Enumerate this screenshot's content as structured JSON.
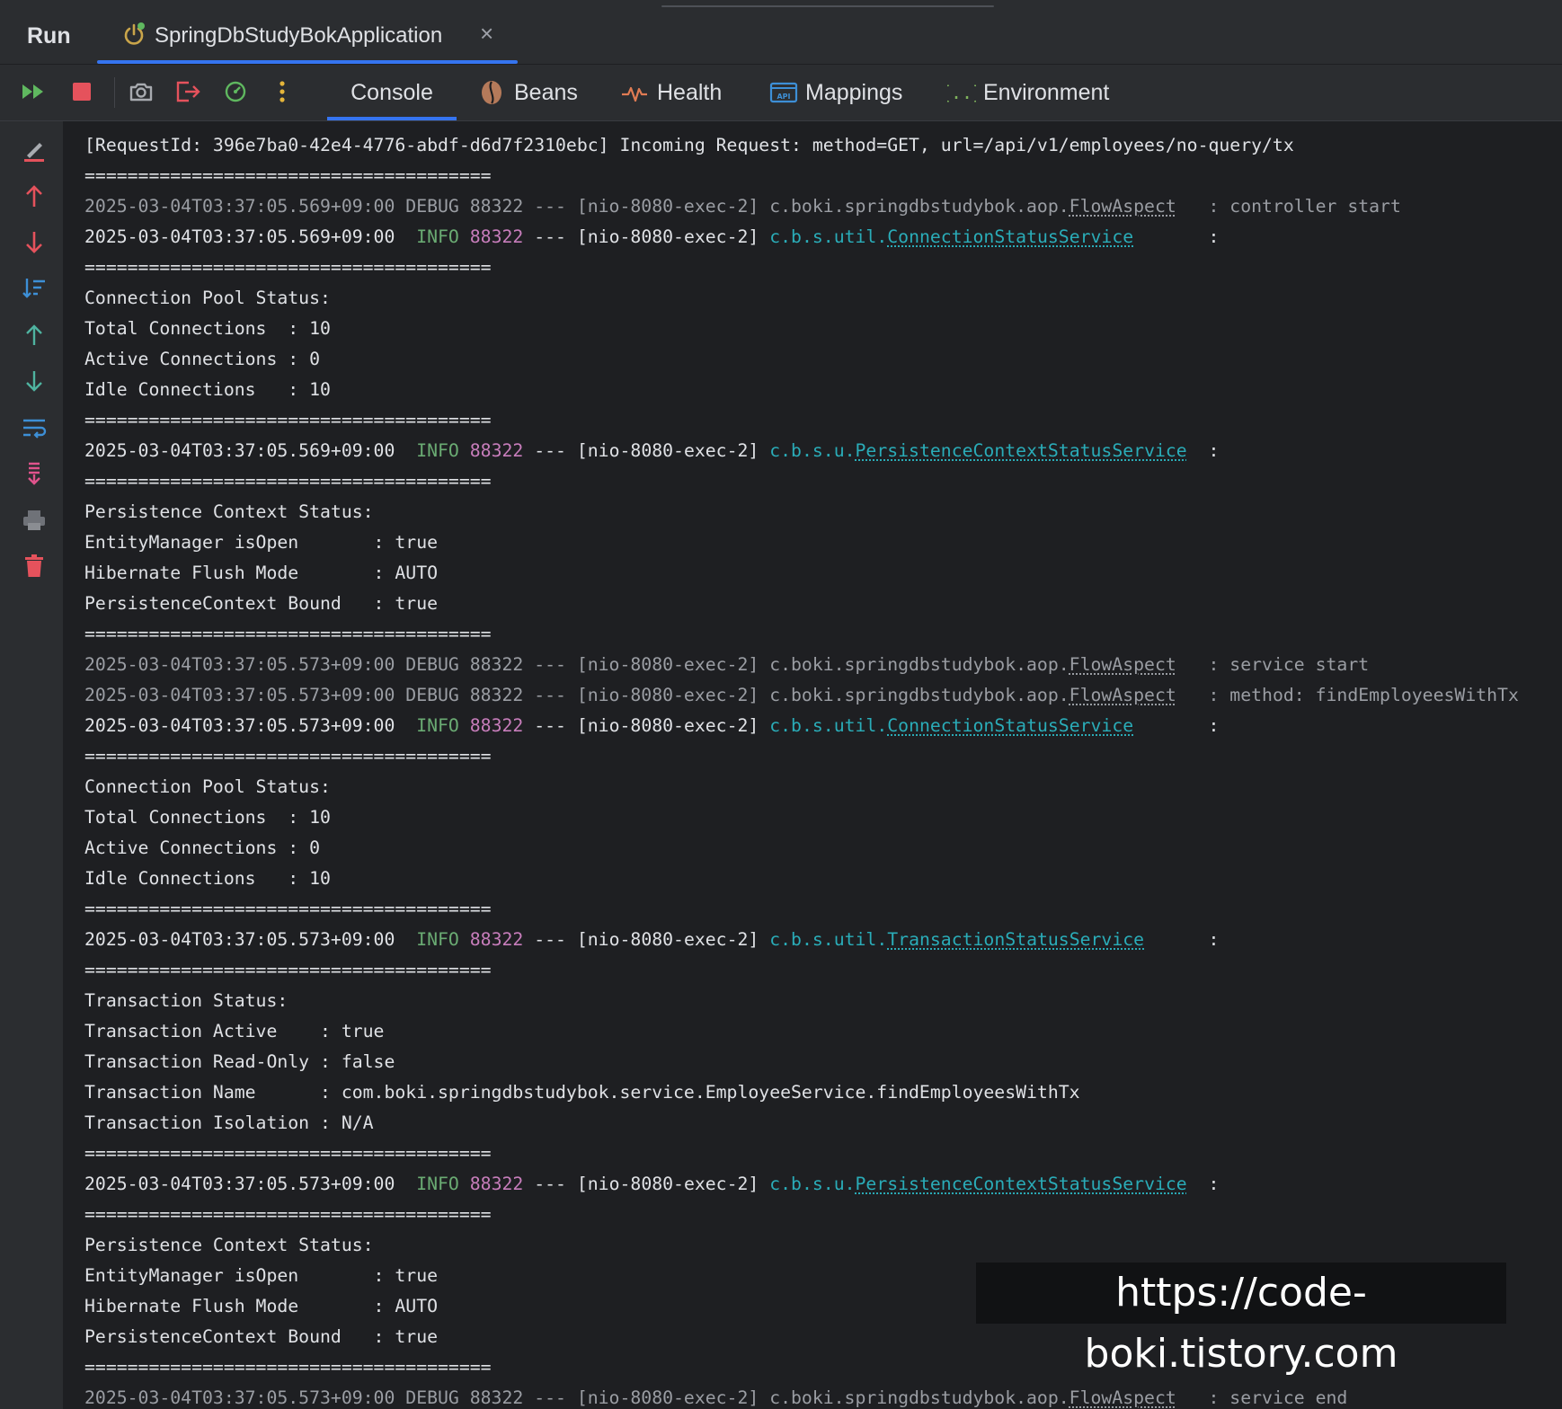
{
  "run_panel": {
    "label": "Run",
    "tab_title": "SpringDbStudyBokApplication",
    "close_glyph": "×"
  },
  "toolbar": {
    "icons": [
      "rerun-icon",
      "stop-icon",
      "camera-icon",
      "exit-icon",
      "profiler-icon",
      "more-icon"
    ],
    "tabs": [
      {
        "label": "Console",
        "icon": "console-icon",
        "active": true
      },
      {
        "label": "Beans",
        "icon": "beans-icon",
        "active": false
      },
      {
        "label": "Health",
        "icon": "health-icon",
        "active": false
      },
      {
        "label": "Mappings",
        "icon": "api-icon",
        "active": false
      },
      {
        "label": "Environment",
        "icon": "braces-icon",
        "active": false
      }
    ]
  },
  "gutter": {
    "icons": [
      "clear-icon",
      "up-red-icon",
      "down-red-icon",
      "sort-icon",
      "up-arrow-icon",
      "down-arrow-icon",
      "soft-wrap-icon",
      "scroll-to-end-icon",
      "print-icon",
      "trash-icon"
    ]
  },
  "log_lines": [
    {
      "segments": [
        {
          "text": "[RequestId: 396e7ba0-42e4-4776-abdf-d6d7f2310ebc] Incoming Request: method=GET, url=/api/v1/employees/no-query/tx",
          "style": "plain"
        }
      ]
    },
    {
      "segments": [
        {
          "text": "======================================",
          "style": "plain"
        }
      ]
    },
    {
      "segments": [
        {
          "text": "2025-03-04T03:37:05.569+09:00 DEBUG 88322 --- [nio-8080-exec-2] c.boki.springdbstudybok.aop.",
          "style": "dim"
        },
        {
          "text": "FlowAspect",
          "style": "dimcls"
        },
        {
          "text": "   : controller start",
          "style": "dim"
        }
      ]
    },
    {
      "segments": [
        {
          "text": "2025-03-04T03:37:05.569+09:00  ",
          "style": "plain"
        },
        {
          "text": "INFO",
          "style": "green"
        },
        {
          "text": " ",
          "style": "plain"
        },
        {
          "text": "88322",
          "style": "magenta"
        },
        {
          "text": " --- [nio-8080-exec-2] ",
          "style": "plain"
        },
        {
          "text": "c.b.s.util.",
          "style": "cyan"
        },
        {
          "text": "ConnectionStatusService",
          "style": "cls"
        },
        {
          "text": "       :",
          "style": "plain"
        }
      ]
    },
    {
      "segments": [
        {
          "text": "======================================",
          "style": "plain"
        }
      ]
    },
    {
      "segments": [
        {
          "text": "Connection Pool Status:",
          "style": "plain"
        }
      ]
    },
    {
      "segments": [
        {
          "text": "Total Connections  : 10",
          "style": "plain"
        }
      ]
    },
    {
      "segments": [
        {
          "text": "Active Connections : 0",
          "style": "plain"
        }
      ]
    },
    {
      "segments": [
        {
          "text": "Idle Connections   : 10",
          "style": "plain"
        }
      ]
    },
    {
      "segments": [
        {
          "text": "======================================",
          "style": "plain"
        }
      ]
    },
    {
      "segments": [
        {
          "text": "2025-03-04T03:37:05.569+09:00  ",
          "style": "plain"
        },
        {
          "text": "INFO",
          "style": "green"
        },
        {
          "text": " ",
          "style": "plain"
        },
        {
          "text": "88322",
          "style": "magenta"
        },
        {
          "text": " --- [nio-8080-exec-2] ",
          "style": "plain"
        },
        {
          "text": "c.b.s.u.",
          "style": "cyan"
        },
        {
          "text": "PersistenceContextStatusService",
          "style": "cls"
        },
        {
          "text": "  :",
          "style": "plain"
        }
      ]
    },
    {
      "segments": [
        {
          "text": "======================================",
          "style": "plain"
        }
      ]
    },
    {
      "segments": [
        {
          "text": "Persistence Context Status:",
          "style": "plain"
        }
      ]
    },
    {
      "segments": [
        {
          "text": "EntityManager isOpen       : true",
          "style": "plain"
        }
      ]
    },
    {
      "segments": [
        {
          "text": "Hibernate Flush Mode       : AUTO",
          "style": "plain"
        }
      ]
    },
    {
      "segments": [
        {
          "text": "PersistenceContext Bound   : true",
          "style": "plain"
        }
      ]
    },
    {
      "segments": [
        {
          "text": "======================================",
          "style": "plain"
        }
      ]
    },
    {
      "segments": [
        {
          "text": "2025-03-04T03:37:05.573+09:00 DEBUG 88322 --- [nio-8080-exec-2] c.boki.springdbstudybok.aop.",
          "style": "dim"
        },
        {
          "text": "FlowAspect",
          "style": "dimcls"
        },
        {
          "text": "   : service start",
          "style": "dim"
        }
      ]
    },
    {
      "segments": [
        {
          "text": "2025-03-04T03:37:05.573+09:00 DEBUG 88322 --- [nio-8080-exec-2] c.boki.springdbstudybok.aop.",
          "style": "dim"
        },
        {
          "text": "FlowAspect",
          "style": "dimcls"
        },
        {
          "text": "   : method: findEmployeesWithTx",
          "style": "dim"
        }
      ]
    },
    {
      "segments": [
        {
          "text": "2025-03-04T03:37:05.573+09:00  ",
          "style": "plain"
        },
        {
          "text": "INFO",
          "style": "green"
        },
        {
          "text": " ",
          "style": "plain"
        },
        {
          "text": "88322",
          "style": "magenta"
        },
        {
          "text": " --- [nio-8080-exec-2] ",
          "style": "plain"
        },
        {
          "text": "c.b.s.util.",
          "style": "cyan"
        },
        {
          "text": "ConnectionStatusService",
          "style": "cls"
        },
        {
          "text": "       :",
          "style": "plain"
        }
      ]
    },
    {
      "segments": [
        {
          "text": "======================================",
          "style": "plain"
        }
      ]
    },
    {
      "segments": [
        {
          "text": "Connection Pool Status:",
          "style": "plain"
        }
      ]
    },
    {
      "segments": [
        {
          "text": "Total Connections  : 10",
          "style": "plain"
        }
      ]
    },
    {
      "segments": [
        {
          "text": "Active Connections : 0",
          "style": "plain"
        }
      ]
    },
    {
      "segments": [
        {
          "text": "Idle Connections   : 10",
          "style": "plain"
        }
      ]
    },
    {
      "segments": [
        {
          "text": "======================================",
          "style": "plain"
        }
      ]
    },
    {
      "segments": [
        {
          "text": "2025-03-04T03:37:05.573+09:00  ",
          "style": "plain"
        },
        {
          "text": "INFO",
          "style": "green"
        },
        {
          "text": " ",
          "style": "plain"
        },
        {
          "text": "88322",
          "style": "magenta"
        },
        {
          "text": " --- [nio-8080-exec-2] ",
          "style": "plain"
        },
        {
          "text": "c.b.s.util.",
          "style": "cyan"
        },
        {
          "text": "TransactionStatusService",
          "style": "cls"
        },
        {
          "text": "      :",
          "style": "plain"
        }
      ]
    },
    {
      "segments": [
        {
          "text": "======================================",
          "style": "plain"
        }
      ]
    },
    {
      "segments": [
        {
          "text": "Transaction Status:",
          "style": "plain"
        }
      ]
    },
    {
      "segments": [
        {
          "text": "Transaction Active    : true",
          "style": "plain"
        }
      ]
    },
    {
      "segments": [
        {
          "text": "Transaction Read-Only : false",
          "style": "plain"
        }
      ]
    },
    {
      "segments": [
        {
          "text": "Transaction Name      : com.boki.springdbstudybok.service.EmployeeService.findEmployeesWithTx",
          "style": "plain"
        }
      ]
    },
    {
      "segments": [
        {
          "text": "Transaction Isolation : N/A",
          "style": "plain"
        }
      ]
    },
    {
      "segments": [
        {
          "text": "======================================",
          "style": "plain"
        }
      ]
    },
    {
      "segments": [
        {
          "text": "2025-03-04T03:37:05.573+09:00  ",
          "style": "plain"
        },
        {
          "text": "INFO",
          "style": "green"
        },
        {
          "text": " ",
          "style": "plain"
        },
        {
          "text": "88322",
          "style": "magenta"
        },
        {
          "text": " --- [nio-8080-exec-2] ",
          "style": "plain"
        },
        {
          "text": "c.b.s.u.",
          "style": "cyan"
        },
        {
          "text": "PersistenceContextStatusService",
          "style": "cls"
        },
        {
          "text": "  :",
          "style": "plain"
        }
      ]
    },
    {
      "segments": [
        {
          "text": "======================================",
          "style": "plain"
        }
      ]
    },
    {
      "segments": [
        {
          "text": "Persistence Context Status:",
          "style": "plain"
        }
      ]
    },
    {
      "segments": [
        {
          "text": "EntityManager isOpen       : true",
          "style": "plain"
        }
      ]
    },
    {
      "segments": [
        {
          "text": "Hibernate Flush Mode       : AUTO",
          "style": "plain"
        }
      ]
    },
    {
      "segments": [
        {
          "text": "PersistenceContext Bound   : true",
          "style": "plain"
        }
      ]
    },
    {
      "segments": [
        {
          "text": "======================================",
          "style": "plain"
        }
      ]
    },
    {
      "segments": [
        {
          "text": "2025-03-04T03:37:05.573+09:00 DEBUG 88322 --- [nio-8080-exec-2] c.boki.springdbstudybok.aop.",
          "style": "dim"
        },
        {
          "text": "FlowAspect",
          "style": "dimcls"
        },
        {
          "text": "   : service end",
          "style": "dim"
        }
      ]
    }
  ],
  "watermark": "https://code-boki.tistory.com",
  "colors": {
    "accent": "#3574f0",
    "info": "#6aab73",
    "pid": "#c77dbb",
    "logger": "#2aacb8",
    "debug_text": "#9a9da3",
    "stop": "#e5525c"
  }
}
